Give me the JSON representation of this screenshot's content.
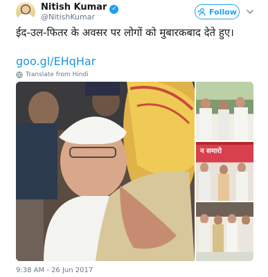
{
  "user": {
    "name": "Nitish Kumar",
    "handle": "@NitishKumar"
  },
  "follow_button": {
    "label": "Follow"
  },
  "tweet": {
    "text": "ईद-उल-फितर के अवसर पर लोगों को मुबारकबाद देते हुए।",
    "link": "goo.gl/EHqHar",
    "translate_label": "Translate from Hindi",
    "timestamp": "9:38 AM - 26 Jun 2017"
  },
  "media": {
    "side_photo_2_banner": "न समारो"
  },
  "icons": {
    "verified": "verified-badge-icon",
    "follow": "add-user-icon",
    "menu": "chevron-down-icon",
    "translate": "globe-icon"
  },
  "colors": {
    "accent": "#1da1f2",
    "link": "#1b95e0",
    "muted": "#657786"
  }
}
